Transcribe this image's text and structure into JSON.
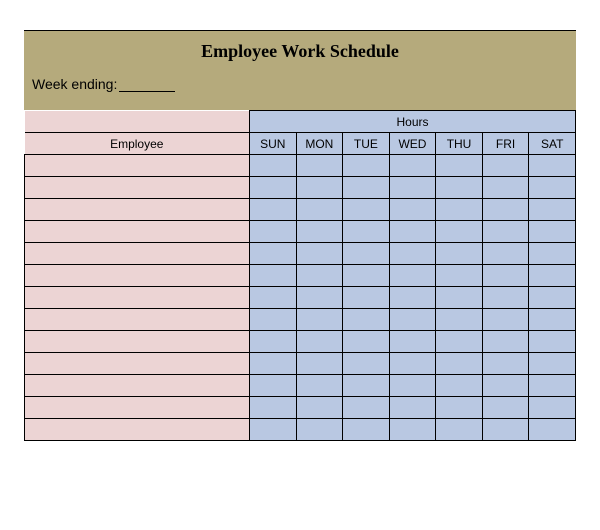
{
  "title": "Employee Work Schedule",
  "week_ending_label": "Week ending:",
  "week_ending_value": "",
  "columns": {
    "employee": "Employee",
    "hours": "Hours",
    "days": [
      "SUN",
      "MON",
      "TUE",
      "WED",
      "THU",
      "FRI",
      "SAT"
    ]
  },
  "rows": [
    {
      "employee": "",
      "hours": [
        "",
        "",
        "",
        "",
        "",
        "",
        ""
      ]
    },
    {
      "employee": "",
      "hours": [
        "",
        "",
        "",
        "",
        "",
        "",
        ""
      ]
    },
    {
      "employee": "",
      "hours": [
        "",
        "",
        "",
        "",
        "",
        "",
        ""
      ]
    },
    {
      "employee": "",
      "hours": [
        "",
        "",
        "",
        "",
        "",
        "",
        ""
      ]
    },
    {
      "employee": "",
      "hours": [
        "",
        "",
        "",
        "",
        "",
        "",
        ""
      ]
    },
    {
      "employee": "",
      "hours": [
        "",
        "",
        "",
        "",
        "",
        "",
        ""
      ]
    },
    {
      "employee": "",
      "hours": [
        "",
        "",
        "",
        "",
        "",
        "",
        ""
      ]
    },
    {
      "employee": "",
      "hours": [
        "",
        "",
        "",
        "",
        "",
        "",
        ""
      ]
    },
    {
      "employee": "",
      "hours": [
        "",
        "",
        "",
        "",
        "",
        "",
        ""
      ]
    },
    {
      "employee": "",
      "hours": [
        "",
        "",
        "",
        "",
        "",
        "",
        ""
      ]
    },
    {
      "employee": "",
      "hours": [
        "",
        "",
        "",
        "",
        "",
        "",
        ""
      ]
    },
    {
      "employee": "",
      "hours": [
        "",
        "",
        "",
        "",
        "",
        "",
        ""
      ]
    },
    {
      "employee": "",
      "hours": [
        "",
        "",
        "",
        "",
        "",
        "",
        ""
      ]
    }
  ]
}
